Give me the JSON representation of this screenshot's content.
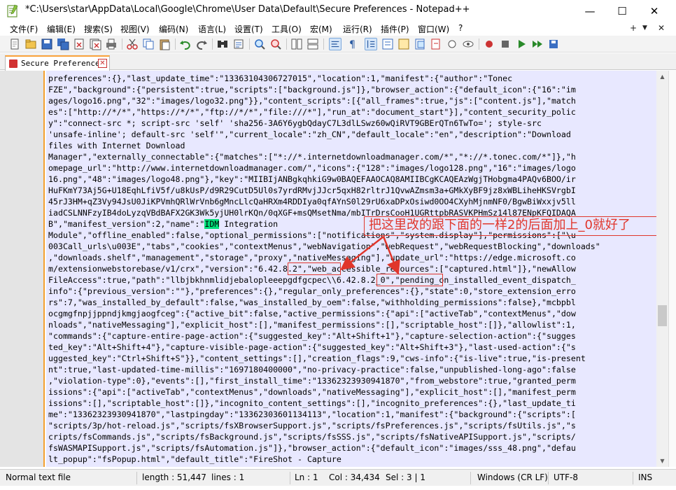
{
  "window": {
    "title": "*C:\\Users\\star\\AppData\\Local\\Google\\Chrome\\User Data\\Default\\Secure Preferences - Notepad++",
    "minimize": "—",
    "maximize": "☐",
    "close": "✕"
  },
  "menu": {
    "items": [
      "文件(F)",
      "编辑(E)",
      "搜索(S)",
      "视图(V)",
      "编码(N)",
      "语言(L)",
      "设置(T)",
      "工具(O)",
      "宏(M)",
      "运行(R)",
      "插件(P)",
      "窗口(W)",
      "?"
    ],
    "plus": "+",
    "dropdown": "▼",
    "close": "✕"
  },
  "tab": {
    "label": "Secure Preferences",
    "close": "✕"
  },
  "editor": {
    "lines": [
      "preferences\":{},\"last_update_time\":\"13363104306727015\",\"location\":1,\"manifest\":{\"author\":\"Tonec",
      "FZE\",\"background\":{\"persistent\":true,\"scripts\":[\"background.js\"]},\"browser_action\":{\"default_icon\":{\"16\":\"im",
      "ages/logo16.png\",\"32\":\"images/logo32.png\"}},\"content_scripts\":[{\"all_frames\":true,\"js\":[\"content.js\"],\"match",
      "es\":[\"http://*/*\",\"https://*/*\",\"ftp://*/*\",\"file:///*\"],\"run_at\":\"document_start\"}],\"content_security_polic",
      "y\":\"connect-src *; script-src 'self' 'sha256-3A6Y6ygbQdayC7L3dlLSwz60wQiRVT9GBErQTn6TwTo='; style-src",
      "'unsafe-inline'; default-src 'self'\",\"current_locale\":\"zh_CN\",\"default_locale\":\"en\",\"description\":\"Download",
      "files with Internet Download",
      "Manager\",\"externally_connectable\":{\"matches\":[\"*://*.internetdownloadmanager.com/*\",\"*://*.tonec.com/*\"]},\"h",
      "omepage_url\":\"http://www.internetdownloadmanager.com/\",\"icons\":{\"128\":\"images/logo128.png\",\"16\":\"images/logo",
      "16.png\",\"48\":\"images/logo48.png\"},\"key\":\"MIIBIjANBgkqhkiG9w0BAQEFAAOCAQ8AMIIBCgKCAQEAzWgjTHobgma4PAQv6BOO/ir",
      "HuFKmY73Aj5G+U18EqhLfiV5f/u8kUsP/d9R29CutD5Ul0s7yrdRMvjJJcr5qxH82rltrJ1QvwAZmsm3a+GMkXyBF9jz8xWBLiheHKSVrgbI",
      "45rJ3HM+qZ3Vy94JsU0JiKPVmhQRlWrVnb6gMncLlcQaHRXm4RDDIya0qfAYnS0l29rU6xaDPxOsiwd0OO4CXyhMjnmNF0/BgwBiWxxjv5ll",
      "iadCSLNNFzyIB4doLyzqVBdBAFX2GK3Wk5yjUH0lrKQn/0qXGF+msQMsetNma/mbITrDrsCooH1UGRttpbRASVKPHmSz14l87ENpKFQIDAQA",
      "B\",\"manifest_version\":2,\"name\":\"IDM Integration",
      "Module\",\"offline_enabled\":false,\"optional_permissions\":[\"notifications\",\"system.display\"],\"permissions\":[\"\\u",
      "003Call_urls\\u003E\",\"tabs\",\"cookies\",\"contextMenus\",\"webNavigation\",\"webRequest\",\"webRequestBlocking\",\"downloads\"",
      ",\"downloads.shelf\",\"management\",\"storage\",\"proxy\",\"nativeMessaging\"],\"update_url\":\"https://edge.microsoft.co",
      "m/extensionwebstorebase/v1/crx\",\"version\":\"6.42.8.2\",\"web_accessible_resources\":[\"captured.html\"]},\"newAllow",
      "FileAccess\":true,\"path\":\"llbjbkhnmlidjebalopleeepgdfgcpec\\\\6.42.8.2_0\",\"pending_on_installed_event_dispatch_",
      "info\":{\"previous_version\":\"\"},\"preferences\":{},\"regular_only_preferences\":{},\"state\":0,\"store_extension_erro",
      "rs\":7,\"was_installed_by_default\":false,\"was_installed_by_oem\":false,\"withholding_permissions\":false},\"mcbpbl",
      "ocgmgfnpjjppndjkmgjaogfceg\":{\"active_bit\":false,\"active_permissions\":{\"api\":[\"activeTab\",\"contextMenus\",\"dow",
      "nloads\",\"nativeMessaging\"],\"explicit_host\":[],\"manifest_permissions\":[],\"scriptable_host\":[]},\"allowlist\":1,",
      "\"commands\":{\"capture-entire-page-action\":{\"suggested_key\":\"Alt+Shift+1\"},\"capture-selection-action\":{\"sugges",
      "ted_key\":\"Alt+Shift+4\"},\"capture-visible-page-action\":{\"suggested_key\":\"Alt+Shift+3\"},\"last-used-action\":{\"s",
      "uggested_key\":\"Ctrl+Shift+S\"}},\"content_settings\":[],\"creation_flags\":9,\"cws-info\":{\"is-live\":true,\"is-present",
      "nt\":true,\"last-updated-time-millis\":\"1697180400000\",\"no-privacy-practice\":false,\"unpublished-long-ago\":false",
      ",\"violation-type\":0},\"events\":[],\"first_install_time\":\"13362323930941870\",\"from_webstore\":true,\"granted_perm",
      "issions\":{\"api\":[\"activeTab\",\"contextMenus\",\"downloads\",\"nativeMessaging\"],\"explicit_host\":[],\"manifest_perm",
      "issions\":[],\"scriptable_host\":[]},\"incognito_content_settings\":[],\"incognito_preferences\":{},\"last_update_ti",
      "me\":\"13362323930941870\",\"lastpingday\":\"13362303601134113\",\"location\":1,\"manifest\":{\"background\":{\"scripts\":[",
      "\"scripts/3p/hot-reload.js\",\"scripts/fsXBrowserSupport.js\",\"scripts/fsPreferences.js\",\"scripts/fsUtils.js\",\"s",
      "cripts/fsCommands.js\",\"scripts/fsBackground.js\",\"scripts/fsSSS.js\",\"scripts/fsNativeAPISupport.js\",\"scripts/",
      "fsWASMAPISupport.js\",\"scripts/fsAutomation.js\"]},\"browser_action\":{\"default_icon\":\"images/sss_48.png\",\"defau",
      "lt_popup\":\"fsPopup.html\",\"default_title\":\"FireShot - Capture"
    ],
    "highlight_word": "IDM",
    "annotation": "把这里改的跟下面的一样2的后面加上_0就好了"
  },
  "status": {
    "file_type": "Normal text file",
    "length": "length : 51,447",
    "lines": "lines : 1",
    "ln": "Ln : 1",
    "col": "Col : 34,434",
    "sel": "Sel : 3 | 1",
    "eol": "Windows (CR LF)",
    "encoding": "UTF-8",
    "mode": "INS"
  },
  "colors": {
    "accent": "#f4a030",
    "annotation_red": "#e0362b",
    "selection_bg": "#e8e8ff",
    "highlight_green": "#00e07a"
  }
}
